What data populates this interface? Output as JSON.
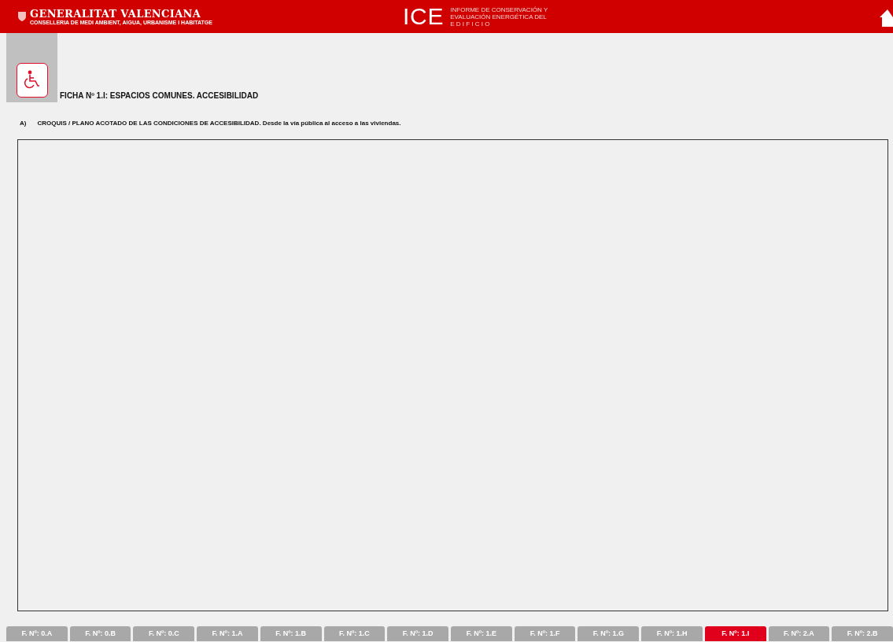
{
  "header": {
    "org_name": "GENERALITAT VALENCIANA",
    "org_subtitle": "CONSELLERIA DE MEDI AMBIENT, AIGUA, URBANISME I HABITATGE",
    "app_acronym": "ICE",
    "app_line_1": "INFORME DE CONSERVACIÓN Y",
    "app_line_2": "EVALUACIÓN ENERGÉTICA DEL",
    "app_line_3": "E D I F I C I O"
  },
  "sheet": {
    "title": "FICHA Nº 1.I: ESPACIOS COMUNES. ACCESIBILIDAD",
    "section_letter": "A)",
    "section_bold": "CROQUIS / PLANO ACOTADO DE LAS CONDICIONES DE ACCESIBILIDAD.",
    "section_rest": "Desde la vía pública al acceso a las viviendas."
  },
  "tabs": [
    {
      "label": "F. Nº: 0.A",
      "selected": false
    },
    {
      "label": "F. Nº: 0.B",
      "selected": false
    },
    {
      "label": "F. Nº: 0.C",
      "selected": false
    },
    {
      "label": "F. Nº: 1.A",
      "selected": false
    },
    {
      "label": "F. Nº: 1.B",
      "selected": false
    },
    {
      "label": "F. Nº: 1.C",
      "selected": false
    },
    {
      "label": "F. Nº: 1.D",
      "selected": false
    },
    {
      "label": "F. Nº: 1.E",
      "selected": false
    },
    {
      "label": "F. Nº: 1.F",
      "selected": false
    },
    {
      "label": "F. Nº: 1.G",
      "selected": false
    },
    {
      "label": "F. Nº: 1.H",
      "selected": false
    },
    {
      "label": "F. Nº: 1.I",
      "selected": true
    },
    {
      "label": "F. Nº: 2.A",
      "selected": false
    },
    {
      "label": "F. Nº: 2.B",
      "selected": false
    }
  ]
}
